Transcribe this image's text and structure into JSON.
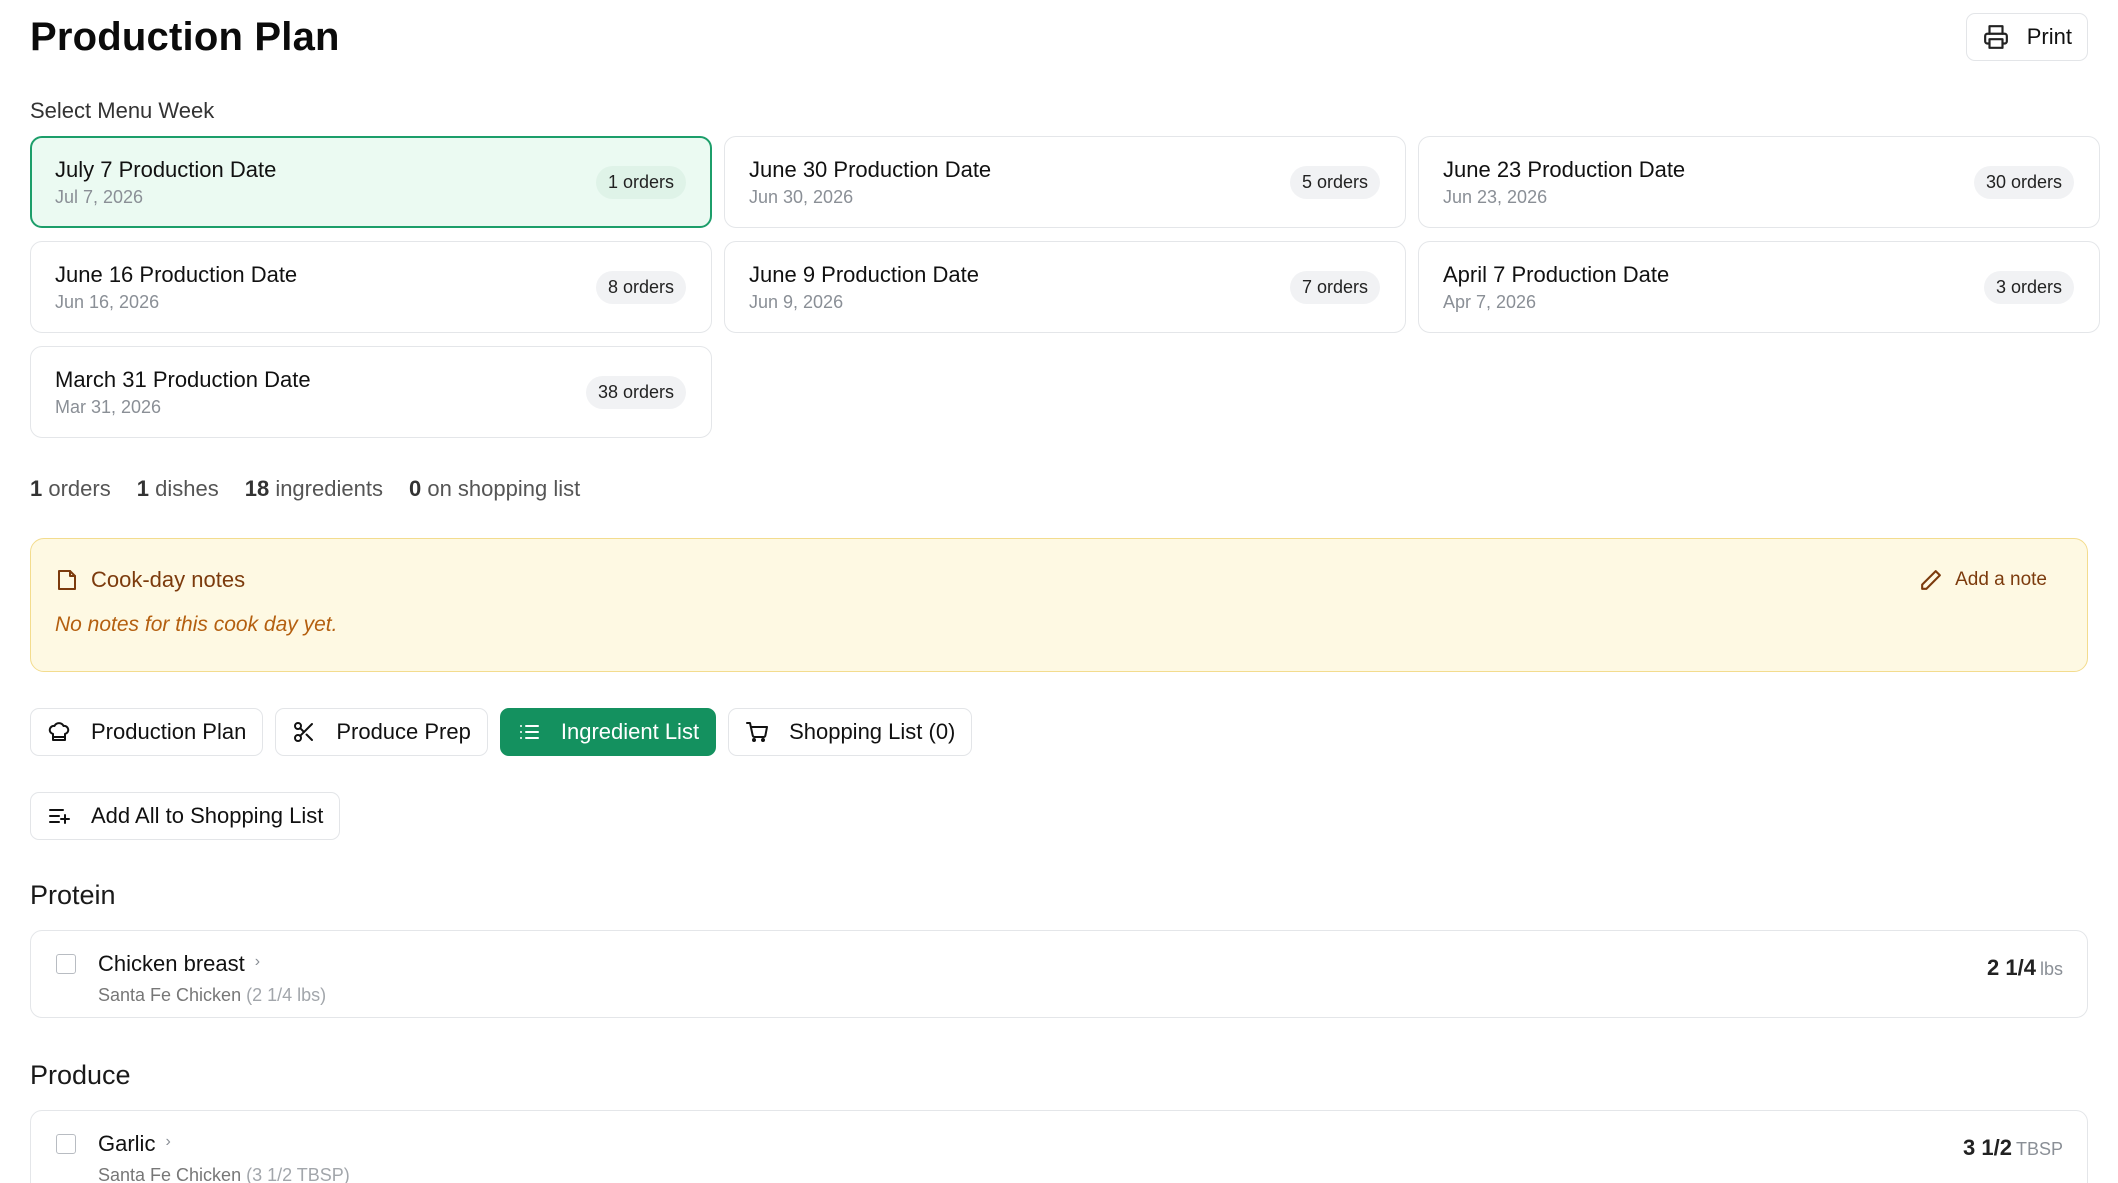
{
  "page": {
    "title": "Production Plan",
    "print_label": "Print"
  },
  "week_select": {
    "label": "Select Menu Week",
    "weeks": [
      {
        "title": "July 7 Production Date",
        "date": "Jul 7, 2026",
        "orders": "1 orders",
        "selected": true
      },
      {
        "title": "June 30 Production Date",
        "date": "Jun 30, 2026",
        "orders": "5 orders"
      },
      {
        "title": "June 23 Production Date",
        "date": "Jun 23, 2026",
        "orders": "30 orders"
      },
      {
        "title": "June 16 Production Date",
        "date": "Jun 16, 2026",
        "orders": "8 orders"
      },
      {
        "title": "June 9 Production Date",
        "date": "Jun 9, 2026",
        "orders": "7 orders"
      },
      {
        "title": "April 7 Production Date",
        "date": "Apr 7, 2026",
        "orders": "3 orders"
      },
      {
        "title": "March 31 Production Date",
        "date": "Mar 31, 2026",
        "orders": "38 orders"
      }
    ]
  },
  "stats": [
    {
      "value": "1",
      "label": "orders"
    },
    {
      "value": "1",
      "label": "dishes"
    },
    {
      "value": "18",
      "label": "ingredients"
    },
    {
      "value": "0",
      "label": "on shopping list"
    }
  ],
  "notes": {
    "title": "Cook-day notes",
    "add_label": "Add a note",
    "empty_text": "No notes for this cook day yet."
  },
  "tabs": [
    {
      "label": "Production Plan",
      "icon": "chef-hat-icon"
    },
    {
      "label": "Produce Prep",
      "icon": "scissors-icon"
    },
    {
      "label": "Ingredient List",
      "icon": "list-icon",
      "active": true
    },
    {
      "label": "Shopping List (0)",
      "icon": "cart-icon"
    }
  ],
  "add_all_label": "Add All to Shopping List",
  "categories": [
    {
      "name": "Protein",
      "items": [
        {
          "name": "Chicken breast",
          "dish": "Santa Fe Chicken",
          "dish_qty": "(2 1/4 lbs)",
          "qty": "2 1/4",
          "unit": "lbs"
        }
      ]
    },
    {
      "name": "Produce",
      "items": [
        {
          "name": "Garlic",
          "dish": "Santa Fe Chicken",
          "dish_qty": "(3 1/2 TBSP)",
          "qty": "3 1/2",
          "unit": "TBSP"
        }
      ]
    }
  ],
  "colors": {
    "accent": "#14915f",
    "selected_bg": "#ebfaf2",
    "notes_bg": "#fef9e3",
    "notes_text": "#7c3b0d"
  }
}
